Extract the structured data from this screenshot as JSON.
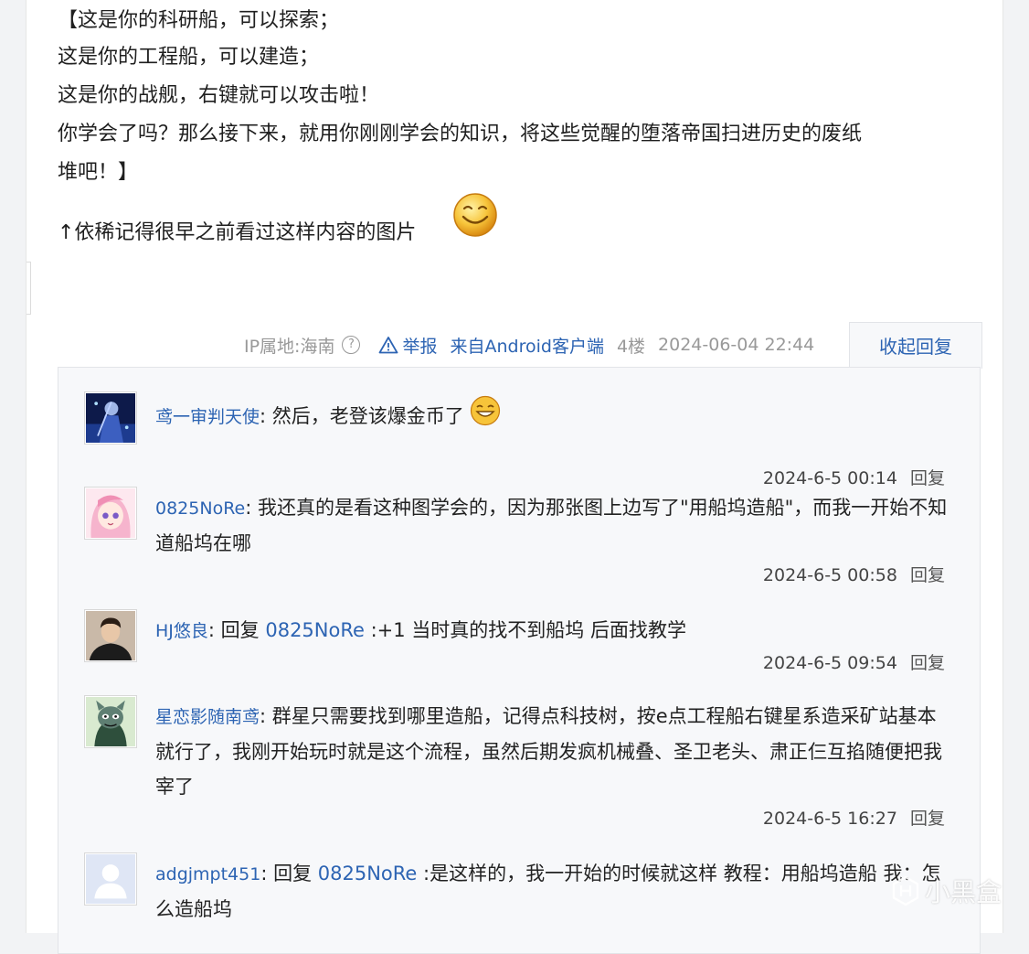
{
  "post": {
    "lines": [
      "【这是你的科研船，可以探索；",
      "这是你的工程船，可以建造；",
      "这是你的战舰，右键就可以攻击啦！",
      "你学会了吗？那么接下来，就用你刚刚学会的知识，将这些觉醒的堕落帝国扫进历史的废纸",
      "堆吧！】",
      "↑依稀记得很早之前看过这样内容的图片"
    ],
    "emoji": "smile-emoji"
  },
  "meta": {
    "ip": "IP属地:海南",
    "help": "?",
    "report": "举报",
    "client": "来自Android客户端",
    "floor": "4楼",
    "time": "2024-06-04 22:44",
    "collapse": "收起回复"
  },
  "replies": [
    {
      "user": "鸢一审判天使",
      "prefix": "",
      "mention": "",
      "text": ": 然后，老登该爆金币了",
      "time": "2024-6-5 00:14",
      "reply_label": "回复",
      "avatar": "anime-dark-avatar"
    },
    {
      "user": "0825NoRe",
      "prefix": "",
      "mention": "",
      "text": ": 我还真的是看这种图学会的，因为那张图上边写了\"用船坞造船\"，而我一开始不知道船坞在哪",
      "time": "2024-6-5 00:58",
      "reply_label": "回复",
      "avatar": "anime-pink-avatar"
    },
    {
      "user": "HJ悠良",
      "prefix": ": 回复 ",
      "mention": "0825NoRe",
      "text": " :+1 当时真的找不到船坞 后面找教学",
      "time": "2024-6-5 09:54",
      "reply_label": "回复",
      "avatar": "photo-avatar"
    },
    {
      "user": "星恋影随南鸢",
      "prefix": "",
      "mention": "",
      "text": ": 群星只需要找到哪里造船，记得点科技树，按e点工程船右键星系造采矿站基本就行了，我刚开始玩时就是这个流程，虽然后期发疯机械叠、圣卫老头、肃正仨互掐随便把我宰了",
      "time": "2024-6-5 16:27",
      "reply_label": "回复",
      "avatar": "cartoon-cat-avatar"
    },
    {
      "user": "adgjmpt451",
      "prefix": ": 回复 ",
      "mention": "0825NoRe",
      "text": " :是这样的，我一开始的时候就这样 教程：用船坞造船 我：怎么造船坞",
      "time": "",
      "reply_label": "",
      "avatar": "default-avatar"
    }
  ],
  "watermark": "小黑盒",
  "colors": {
    "link": "#2d64b3",
    "panel": "#f7f8fa",
    "emoji": "#f5b82e"
  }
}
